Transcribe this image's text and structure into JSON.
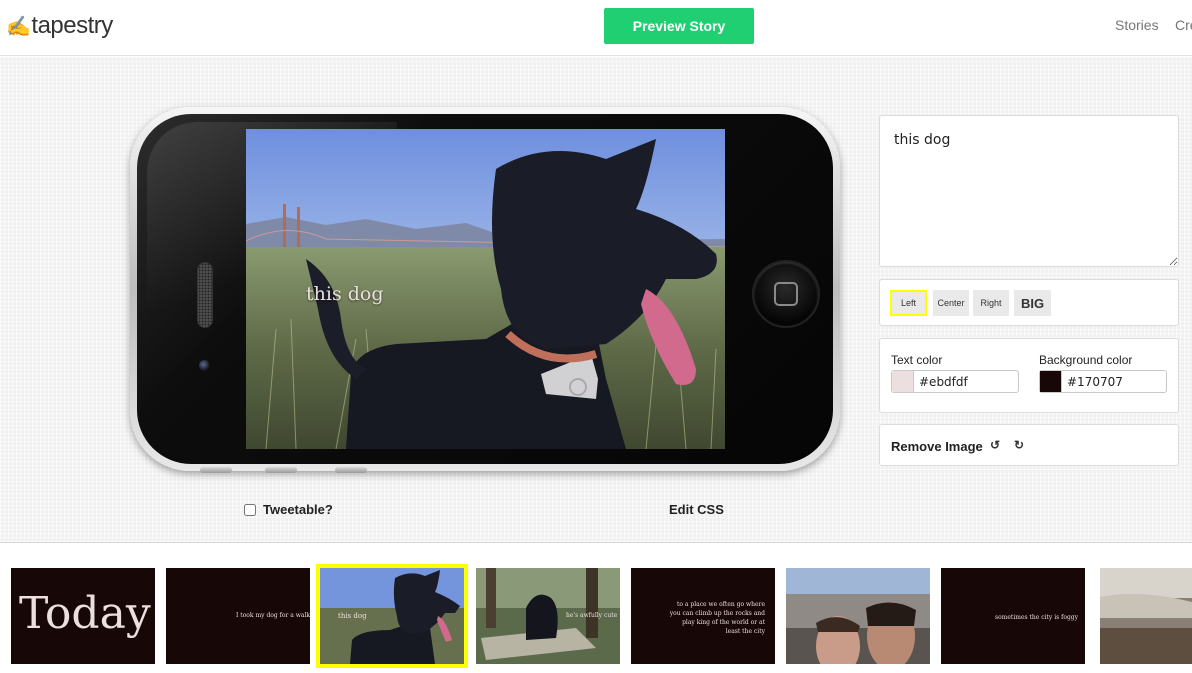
{
  "header": {
    "logo_text": "tapestry",
    "logo_icon": "hand-pointer-icon",
    "preview_label": "Preview Story",
    "nav": [
      "Stories",
      "Cre"
    ]
  },
  "colors": {
    "preview_green": "#1fcf72",
    "selection_yellow": "#ffff00",
    "slide_bg": "#170707",
    "slide_text": "#ebdfdf"
  },
  "slide": {
    "caption": "this dog"
  },
  "below_phone": {
    "tweetable_label": "Tweetable?",
    "tweetable_checked": false,
    "edit_css_label": "Edit CSS"
  },
  "panel": {
    "caption_value": "this dog",
    "align_buttons": [
      "Left",
      "Center",
      "Right",
      "BIG"
    ],
    "selected_align": "Left",
    "text_color_label": "Text color",
    "text_color_value": "#ebdfdf",
    "bg_color_label": "Background color",
    "bg_color_value": "#170707",
    "remove_image_label": "Remove Image",
    "rotate_left_icon": "rotate-left-icon",
    "rotate_right_icon": "rotate-right-icon"
  },
  "filmstrip": [
    {
      "type": "text",
      "text": "Today"
    },
    {
      "type": "text",
      "text": "I took my dog for a walk"
    },
    {
      "type": "photo",
      "text": "this dog",
      "selected": true
    },
    {
      "type": "photo",
      "text": "he's awfully cute"
    },
    {
      "type": "text",
      "text": "to a place we often go where you can climb up the rocks and play king of the world or at least the city"
    },
    {
      "type": "photo",
      "text": ""
    },
    {
      "type": "text",
      "text": "sometimes the city is foggy"
    },
    {
      "type": "photo",
      "text": ""
    }
  ]
}
